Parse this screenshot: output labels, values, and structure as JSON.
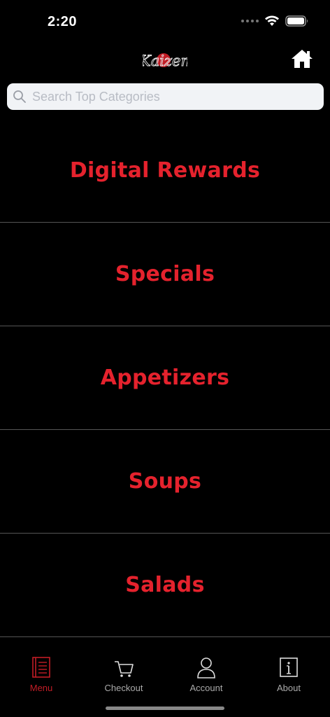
{
  "status_bar": {
    "time": "2:20"
  },
  "header": {
    "logo_text": "Kaizen"
  },
  "search": {
    "placeholder": "Search Top Categories"
  },
  "categories": [
    "Digital Rewards",
    "Specials",
    "Appetizers",
    "Soups",
    "Salads"
  ],
  "tabs": [
    {
      "label": "Menu",
      "icon": "menu-book-icon",
      "active": true
    },
    {
      "label": "Checkout",
      "icon": "cart-icon",
      "active": false
    },
    {
      "label": "Account",
      "icon": "user-icon",
      "active": false
    },
    {
      "label": "About",
      "icon": "info-icon",
      "active": false
    }
  ],
  "colors": {
    "accent": "#e5222d",
    "active_tab": "#c21d26",
    "background": "#000000"
  }
}
